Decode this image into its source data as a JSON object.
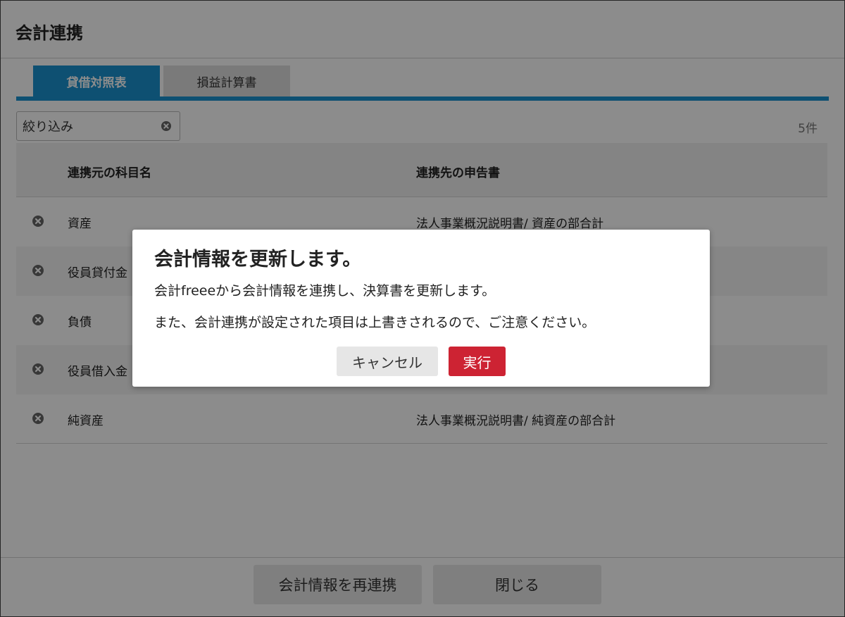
{
  "window": {
    "title": "会計連携"
  },
  "tabs": [
    {
      "label": "貸借対照表",
      "active": true
    },
    {
      "label": "損益計算書",
      "active": false
    }
  ],
  "filter": {
    "placeholder": "絞り込み",
    "clear_icon": "clear-circle-icon"
  },
  "count_label": "5件",
  "table": {
    "headers": [
      "連携元の科目名",
      "連携先の申告書"
    ],
    "rows": [
      {
        "source": "資産",
        "target": "法人事業概況説明書/ 資産の部合計"
      },
      {
        "source": "役員貸付金",
        "target": ""
      },
      {
        "source": "負債",
        "target": ""
      },
      {
        "source": "役員借入金",
        "target": ""
      },
      {
        "source": "純資産",
        "target": "法人事業概況説明書/ 純資産の部合計"
      }
    ]
  },
  "footer": {
    "resync_label": "会計情報を再連携",
    "close_label": "閉じる"
  },
  "dialog": {
    "title": "会計情報を更新します。",
    "message1": "会計freeeから会計情報を連携し、決算書を更新します。",
    "message2": "また、会計連携が設定された項目は上書きされるので、ご注意ください。",
    "cancel_label": "キャンセル",
    "run_label": "実行"
  },
  "colors": {
    "tab_active": "#1a93cf",
    "run_button": "#cd2333",
    "overlay": "rgba(0,0,0,0.45)"
  }
}
